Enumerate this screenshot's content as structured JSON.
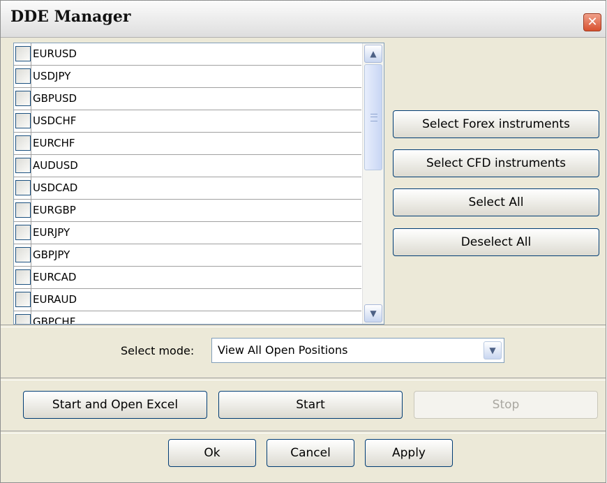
{
  "window": {
    "title": "DDE Manager",
    "close_glyph": "✕"
  },
  "instruments": [
    "EURUSD",
    "USDJPY",
    "GBPUSD",
    "USDCHF",
    "EURCHF",
    "AUDUSD",
    "USDCAD",
    "EURGBP",
    "EURJPY",
    "GBPJPY",
    "EURCAD",
    "EURAUD",
    "GBPCHF"
  ],
  "buttons": {
    "select_forex": "Select Forex instruments",
    "select_cfd": "Select CFD instruments",
    "select_all": "Select All",
    "deselect_all": "Deselect All",
    "start_and_open_excel": "Start and Open Excel",
    "start": "Start",
    "stop": "Stop",
    "ok": "Ok",
    "cancel": "Cancel",
    "apply": "Apply"
  },
  "mode": {
    "label": "Select mode:",
    "value": "View All Open Positions"
  },
  "icons": {
    "scroll_up": "chevron-up-icon",
    "scroll_down": "chevron-down-icon",
    "dropdown": "chevron-down-icon",
    "close": "close-icon"
  },
  "state": {
    "stop_disabled": true
  }
}
